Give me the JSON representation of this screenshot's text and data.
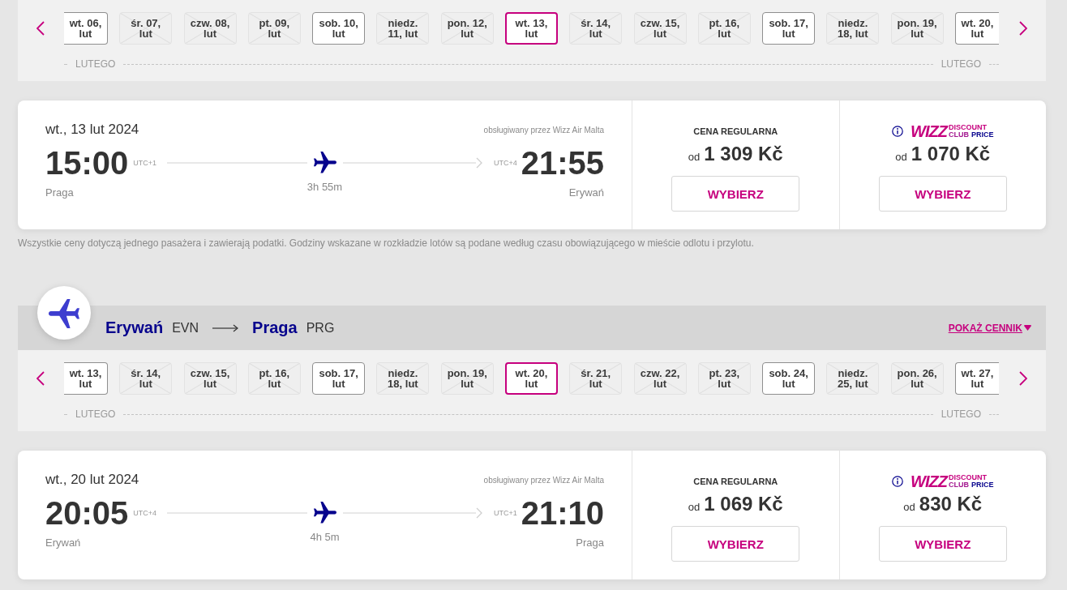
{
  "legs": [
    {
      "date_strip": {
        "days": [
          {
            "label": "wt. 06, lut",
            "disabled": false,
            "selected": false
          },
          {
            "label": "śr. 07, lut",
            "disabled": true,
            "selected": false
          },
          {
            "label": "czw. 08, lut",
            "disabled": true,
            "selected": false
          },
          {
            "label": "pt. 09, lut",
            "disabled": true,
            "selected": false
          },
          {
            "label": "sob. 10, lut",
            "disabled": false,
            "selected": false
          },
          {
            "label": "niedz. 11, lut",
            "disabled": true,
            "selected": false
          },
          {
            "label": "pon. 12, lut",
            "disabled": true,
            "selected": false
          },
          {
            "label": "wt. 13, lut",
            "disabled": false,
            "selected": true
          },
          {
            "label": "śr. 14, lut",
            "disabled": true,
            "selected": false
          },
          {
            "label": "czw. 15, lut",
            "disabled": true,
            "selected": false
          },
          {
            "label": "pt. 16, lut",
            "disabled": true,
            "selected": false
          },
          {
            "label": "sob. 17, lut",
            "disabled": false,
            "selected": false
          },
          {
            "label": "niedz. 18, lut",
            "disabled": true,
            "selected": false
          },
          {
            "label": "pon. 19, lut",
            "disabled": true,
            "selected": false
          },
          {
            "label": "wt. 20, lut",
            "disabled": false,
            "selected": false
          }
        ],
        "month_start": "LUTEGO",
        "month_end": "LUTEGO"
      },
      "flight": {
        "date": "wt., 13 lut 2024",
        "operator": "obsługiwany przez Wizz Air Malta",
        "departure": {
          "time": "15:00",
          "utc": "UTC+1",
          "city": "Praga"
        },
        "duration": "3h 55m",
        "arrival": {
          "utc": "UTC+4",
          "time": "21:55",
          "city": "Erywań"
        },
        "fares": [
          {
            "kind": "regular",
            "title": "CENA REGULARNA",
            "prefix": "od",
            "price": "1 309 Kč",
            "button": "WYBIERZ"
          },
          {
            "kind": "club",
            "logo": {
              "wordmark": "WIZZ",
              "tagline": [
                "DISCOUNT",
                "CLUB",
                "PRICE"
              ]
            },
            "prefix": "od",
            "price": "1 070 Kč",
            "button": "WYBIERZ"
          }
        ]
      },
      "note": "Wszystkie ceny dotyczą jednego pasażera i zawierają podatki. Godziny wskazane w rozkładzie lotów są podane według czasu obowiązującego w mieście odlotu i przylotu."
    },
    {
      "route": {
        "from_city": "Erywań",
        "from_code": "EVN",
        "to_city": "Praga",
        "to_code": "PRG"
      },
      "price_list_link": "POKAŻ CENNIK",
      "date_strip": {
        "days": [
          {
            "label": "wt. 13, lut",
            "disabled": false,
            "selected": false
          },
          {
            "label": "śr. 14, lut",
            "disabled": true,
            "selected": false
          },
          {
            "label": "czw. 15, lut",
            "disabled": true,
            "selected": false
          },
          {
            "label": "pt. 16, lut",
            "disabled": true,
            "selected": false
          },
          {
            "label": "sob. 17, lut",
            "disabled": false,
            "selected": false
          },
          {
            "label": "niedz. 18, lut",
            "disabled": true,
            "selected": false
          },
          {
            "label": "pon. 19, lut",
            "disabled": true,
            "selected": false
          },
          {
            "label": "wt. 20, lut",
            "disabled": false,
            "selected": true
          },
          {
            "label": "śr. 21, lut",
            "disabled": true,
            "selected": false
          },
          {
            "label": "czw. 22, lut",
            "disabled": true,
            "selected": false
          },
          {
            "label": "pt. 23, lut",
            "disabled": true,
            "selected": false
          },
          {
            "label": "sob. 24, lut",
            "disabled": false,
            "selected": false
          },
          {
            "label": "niedz. 25, lut",
            "disabled": true,
            "selected": false
          },
          {
            "label": "pon. 26, lut",
            "disabled": true,
            "selected": false
          },
          {
            "label": "wt. 27, lut",
            "disabled": false,
            "selected": false
          }
        ],
        "month_start": "LUTEGO",
        "month_end": "LUTEGO"
      },
      "flight": {
        "date": "wt., 20 lut 2024",
        "operator": "obsługiwany przez Wizz Air Malta",
        "departure": {
          "time": "20:05",
          "utc": "UTC+4",
          "city": "Erywań"
        },
        "duration": "4h 5m",
        "arrival": {
          "utc": "UTC+1",
          "time": "21:10",
          "city": "Praga"
        },
        "fares": [
          {
            "kind": "regular",
            "title": "CENA REGULARNA",
            "prefix": "od",
            "price": "1 069 Kč",
            "button": "WYBIERZ"
          },
          {
            "kind": "club",
            "logo": {
              "wordmark": "WIZZ",
              "tagline": [
                "DISCOUNT",
                "CLUB",
                "PRICE"
              ]
            },
            "prefix": "od",
            "price": "830 Kč",
            "button": "WYBIERZ"
          }
        ]
      }
    }
  ]
}
